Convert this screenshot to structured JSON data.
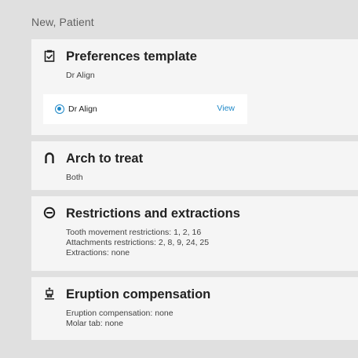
{
  "header": {
    "patient_name": "New, Patient"
  },
  "sections": {
    "preferences": {
      "icon": "clipboard-check-icon",
      "title": "Preferences template",
      "detail": "Dr Align",
      "option": {
        "label": "Dr Align",
        "selected": true,
        "view_label": "View"
      }
    },
    "arch": {
      "icon": "arch-icon",
      "title": "Arch to treat",
      "detail": "Both"
    },
    "restrictions": {
      "icon": "minus-circle-icon",
      "title": "Restrictions and extractions",
      "lines": [
        "Tooth movement restrictions: 1, 2, 16",
        "Attachments restrictions: 2, 8, 9, 24, 25",
        "Extractions: none"
      ]
    },
    "eruption": {
      "icon": "tooth-eruption-icon",
      "title": "Eruption compensation",
      "lines": [
        "Eruption compensation: none",
        "Molar tab: none"
      ]
    }
  },
  "colors": {
    "accent": "#1e88c8",
    "background": "#e0e0e0",
    "card": "#f5f5f5"
  }
}
